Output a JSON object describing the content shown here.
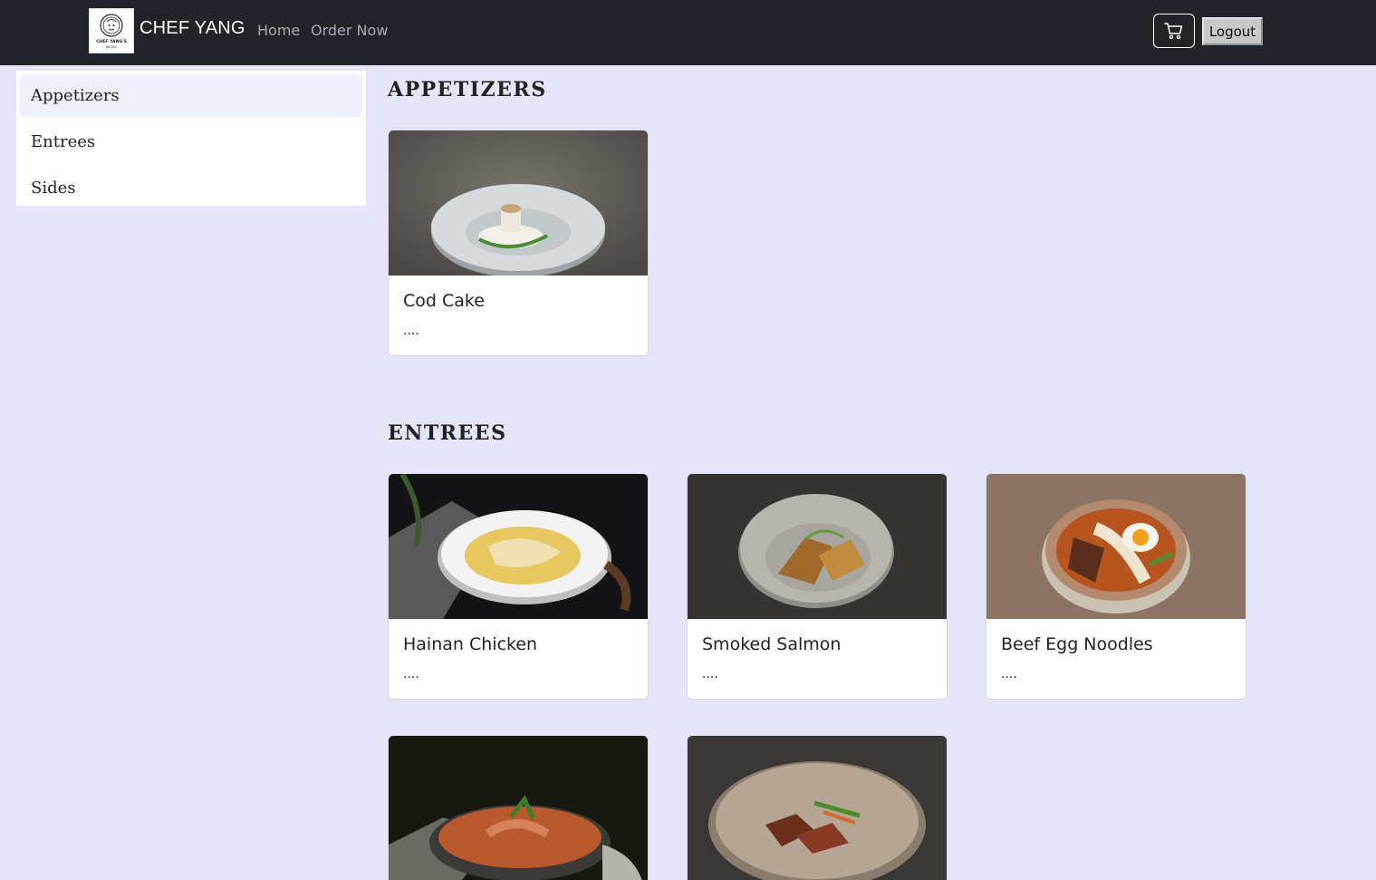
{
  "navbar": {
    "brand": "CHEF YANG",
    "logo_text": "CHEF YANG'S",
    "logo_subtext": "BISTRO",
    "links": [
      {
        "label": "Home"
      },
      {
        "label": "Order Now"
      }
    ],
    "cart_icon": "cart-icon",
    "logout_label": "Logout"
  },
  "sidebar": {
    "items": [
      {
        "label": "Appetizers",
        "active": true
      },
      {
        "label": "Entrees",
        "active": false
      },
      {
        "label": "Sides",
        "active": false
      }
    ]
  },
  "sections": {
    "appetizers": {
      "title": "APPETIZERS",
      "items": [
        {
          "name": "Cod Cake",
          "description": "...."
        }
      ]
    },
    "entrees": {
      "title": "ENTREES",
      "items": [
        {
          "name": "Hainan Chicken",
          "description": "...."
        },
        {
          "name": "Smoked Salmon",
          "description": "...."
        },
        {
          "name": "Beef Egg Noodles",
          "description": "...."
        },
        {
          "name": "",
          "description": ""
        },
        {
          "name": "",
          "description": ""
        }
      ]
    }
  },
  "colors": {
    "navbar_bg": "#212529",
    "page_bg": "#e6e4f7",
    "active_item_bg": "#eff0fc"
  }
}
